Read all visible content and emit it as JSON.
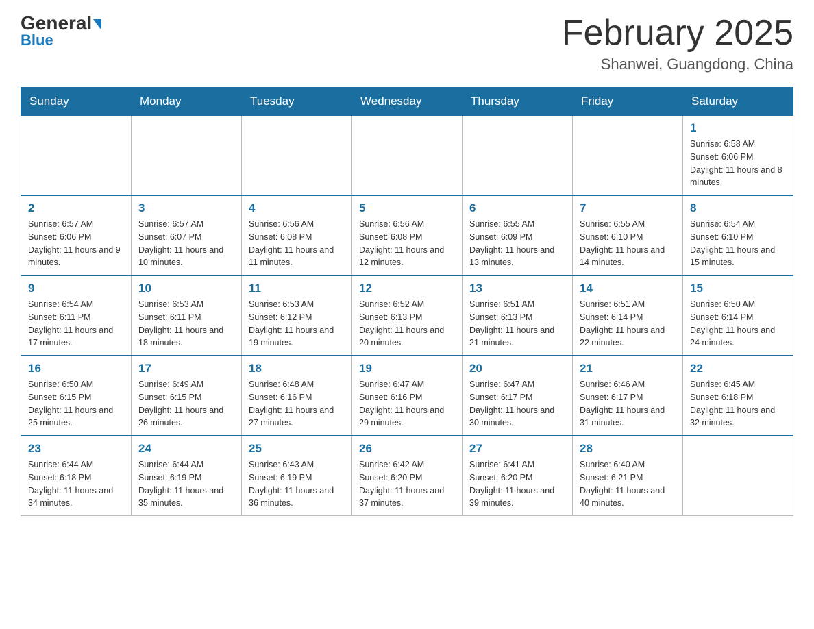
{
  "header": {
    "logo": {
      "general": "General",
      "blue": "Blue"
    },
    "title": "February 2025",
    "location": "Shanwei, Guangdong, China"
  },
  "calendar": {
    "days_of_week": [
      "Sunday",
      "Monday",
      "Tuesday",
      "Wednesday",
      "Thursday",
      "Friday",
      "Saturday"
    ],
    "weeks": [
      {
        "days": [
          {
            "num": "",
            "info": ""
          },
          {
            "num": "",
            "info": ""
          },
          {
            "num": "",
            "info": ""
          },
          {
            "num": "",
            "info": ""
          },
          {
            "num": "",
            "info": ""
          },
          {
            "num": "",
            "info": ""
          },
          {
            "num": "1",
            "info": "Sunrise: 6:58 AM\nSunset: 6:06 PM\nDaylight: 11 hours and 8 minutes."
          }
        ]
      },
      {
        "days": [
          {
            "num": "2",
            "info": "Sunrise: 6:57 AM\nSunset: 6:06 PM\nDaylight: 11 hours and 9 minutes."
          },
          {
            "num": "3",
            "info": "Sunrise: 6:57 AM\nSunset: 6:07 PM\nDaylight: 11 hours and 10 minutes."
          },
          {
            "num": "4",
            "info": "Sunrise: 6:56 AM\nSunset: 6:08 PM\nDaylight: 11 hours and 11 minutes."
          },
          {
            "num": "5",
            "info": "Sunrise: 6:56 AM\nSunset: 6:08 PM\nDaylight: 11 hours and 12 minutes."
          },
          {
            "num": "6",
            "info": "Sunrise: 6:55 AM\nSunset: 6:09 PM\nDaylight: 11 hours and 13 minutes."
          },
          {
            "num": "7",
            "info": "Sunrise: 6:55 AM\nSunset: 6:10 PM\nDaylight: 11 hours and 14 minutes."
          },
          {
            "num": "8",
            "info": "Sunrise: 6:54 AM\nSunset: 6:10 PM\nDaylight: 11 hours and 15 minutes."
          }
        ]
      },
      {
        "days": [
          {
            "num": "9",
            "info": "Sunrise: 6:54 AM\nSunset: 6:11 PM\nDaylight: 11 hours and 17 minutes."
          },
          {
            "num": "10",
            "info": "Sunrise: 6:53 AM\nSunset: 6:11 PM\nDaylight: 11 hours and 18 minutes."
          },
          {
            "num": "11",
            "info": "Sunrise: 6:53 AM\nSunset: 6:12 PM\nDaylight: 11 hours and 19 minutes."
          },
          {
            "num": "12",
            "info": "Sunrise: 6:52 AM\nSunset: 6:13 PM\nDaylight: 11 hours and 20 minutes."
          },
          {
            "num": "13",
            "info": "Sunrise: 6:51 AM\nSunset: 6:13 PM\nDaylight: 11 hours and 21 minutes."
          },
          {
            "num": "14",
            "info": "Sunrise: 6:51 AM\nSunset: 6:14 PM\nDaylight: 11 hours and 22 minutes."
          },
          {
            "num": "15",
            "info": "Sunrise: 6:50 AM\nSunset: 6:14 PM\nDaylight: 11 hours and 24 minutes."
          }
        ]
      },
      {
        "days": [
          {
            "num": "16",
            "info": "Sunrise: 6:50 AM\nSunset: 6:15 PM\nDaylight: 11 hours and 25 minutes."
          },
          {
            "num": "17",
            "info": "Sunrise: 6:49 AM\nSunset: 6:15 PM\nDaylight: 11 hours and 26 minutes."
          },
          {
            "num": "18",
            "info": "Sunrise: 6:48 AM\nSunset: 6:16 PM\nDaylight: 11 hours and 27 minutes."
          },
          {
            "num": "19",
            "info": "Sunrise: 6:47 AM\nSunset: 6:16 PM\nDaylight: 11 hours and 29 minutes."
          },
          {
            "num": "20",
            "info": "Sunrise: 6:47 AM\nSunset: 6:17 PM\nDaylight: 11 hours and 30 minutes."
          },
          {
            "num": "21",
            "info": "Sunrise: 6:46 AM\nSunset: 6:17 PM\nDaylight: 11 hours and 31 minutes."
          },
          {
            "num": "22",
            "info": "Sunrise: 6:45 AM\nSunset: 6:18 PM\nDaylight: 11 hours and 32 minutes."
          }
        ]
      },
      {
        "days": [
          {
            "num": "23",
            "info": "Sunrise: 6:44 AM\nSunset: 6:18 PM\nDaylight: 11 hours and 34 minutes."
          },
          {
            "num": "24",
            "info": "Sunrise: 6:44 AM\nSunset: 6:19 PM\nDaylight: 11 hours and 35 minutes."
          },
          {
            "num": "25",
            "info": "Sunrise: 6:43 AM\nSunset: 6:19 PM\nDaylight: 11 hours and 36 minutes."
          },
          {
            "num": "26",
            "info": "Sunrise: 6:42 AM\nSunset: 6:20 PM\nDaylight: 11 hours and 37 minutes."
          },
          {
            "num": "27",
            "info": "Sunrise: 6:41 AM\nSunset: 6:20 PM\nDaylight: 11 hours and 39 minutes."
          },
          {
            "num": "28",
            "info": "Sunrise: 6:40 AM\nSunset: 6:21 PM\nDaylight: 11 hours and 40 minutes."
          },
          {
            "num": "",
            "info": ""
          }
        ]
      }
    ]
  }
}
